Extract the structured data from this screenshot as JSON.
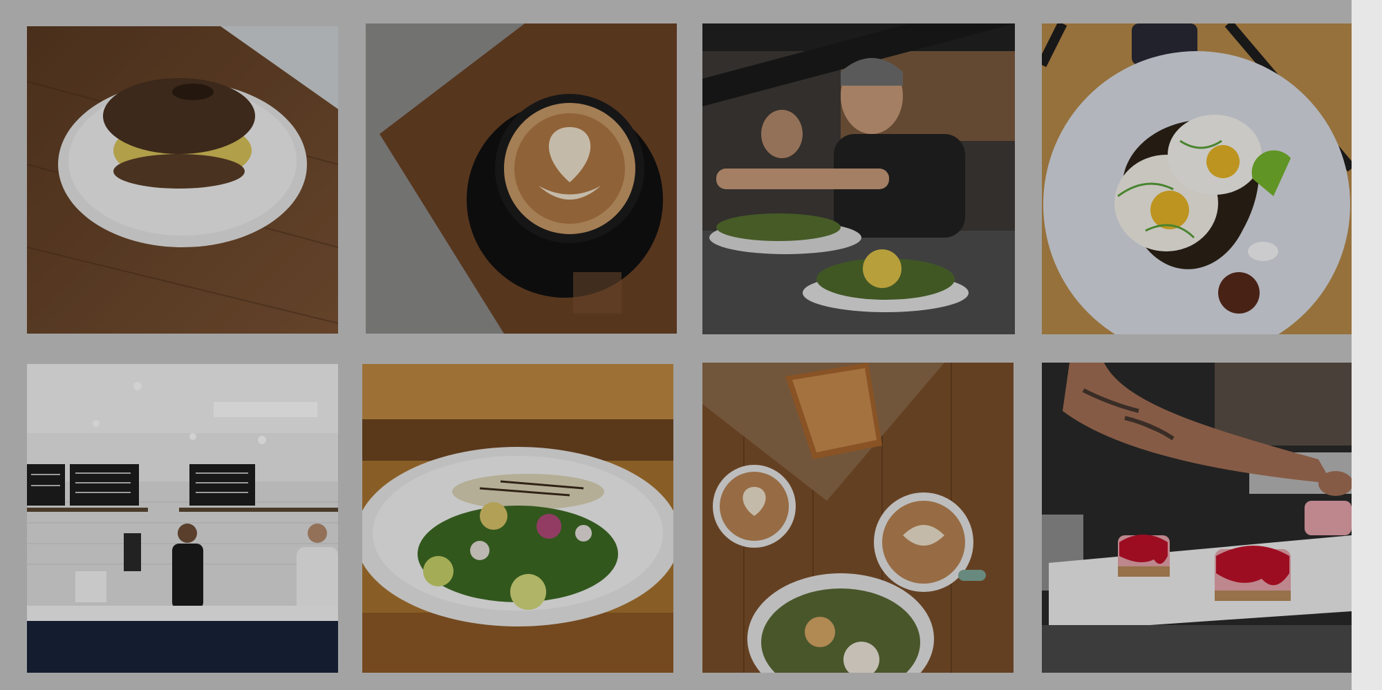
{
  "gallery": {
    "photos": [
      {
        "subject": "bagel-sandwich-photo"
      },
      {
        "subject": "latte-art-photo"
      },
      {
        "subject": "chef-plating-photo"
      },
      {
        "subject": "fried-egg-toast-photo"
      },
      {
        "subject": "cafe-counter-photo"
      },
      {
        "subject": "grilled-salad-photo"
      },
      {
        "subject": "coffee-and-quiche-photo"
      },
      {
        "subject": "cheesecake-plating-photo"
      }
    ]
  },
  "colors": {
    "page_background": "#a3a3a3",
    "scrollbar_track": "#e7e7e7",
    "wood_warm": "#6b4325",
    "plate_white": "#e8e8e8"
  }
}
